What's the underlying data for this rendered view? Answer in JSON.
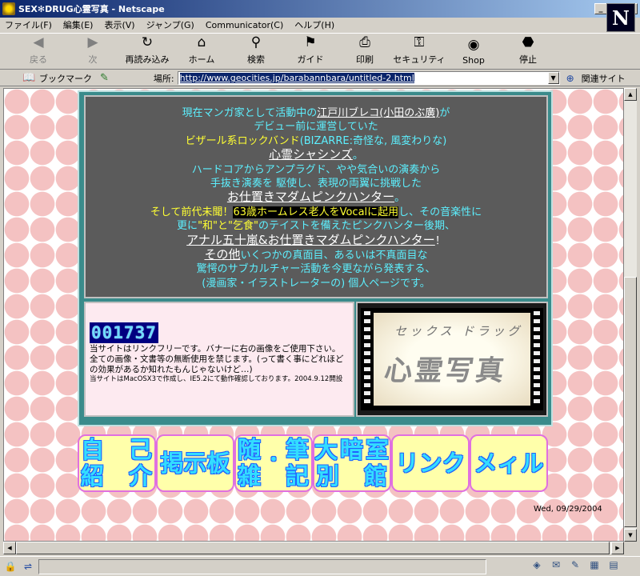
{
  "window": {
    "title": "SEX✻DRUG心霊写真 - Netscape"
  },
  "menu": [
    "ファイル(F)",
    "編集(E)",
    "表示(V)",
    "ジャンプ(G)",
    "Communicator(C)",
    "ヘルプ(H)"
  ],
  "toolbar": [
    {
      "label": "戻る",
      "icon": "back-arrow-icon",
      "glyph": "◀",
      "enabled": false
    },
    {
      "label": "次",
      "icon": "forward-arrow-icon",
      "glyph": "▶",
      "enabled": false
    },
    {
      "label": "再読み込み",
      "icon": "reload-icon",
      "glyph": "↻",
      "enabled": true
    },
    {
      "label": "ホーム",
      "icon": "home-icon",
      "glyph": "⌂",
      "enabled": true
    },
    {
      "label": "検索",
      "icon": "search-icon",
      "glyph": "⚲",
      "enabled": true
    },
    {
      "label": "ガイド",
      "icon": "guide-icon",
      "glyph": "⚑",
      "enabled": true
    },
    {
      "label": "印刷",
      "icon": "print-icon",
      "glyph": "⎙",
      "enabled": true
    },
    {
      "label": "セキュリティ",
      "icon": "lock-icon",
      "glyph": "⚿",
      "enabled": true
    },
    {
      "label": "Shop",
      "icon": "shop-icon",
      "glyph": "◉",
      "enabled": true
    },
    {
      "label": "停止",
      "icon": "stop-icon",
      "glyph": "⬣",
      "enabled": true
    }
  ],
  "logo": "N",
  "location": {
    "bookmark_label": "ブックマーク",
    "label": "場所:",
    "url": "http://www.geocities.jp/barabannbara/untitled-2.html",
    "related_label": "関連サイト"
  },
  "intro": {
    "l1a": "現在マンガ家として活動中の",
    "l1b": "江戸川ブレコ(小田のぶ廣)",
    "l1c": "が",
    "l2": "デビュー前に運営していた",
    "l3a": "ビザール系ロックバンド",
    "l3b": "(BIZARRE:奇怪な, 風変わりな)",
    "l4": "心霊シャシンズ",
    "l4b": "。",
    "l5": "ハードコアからアンプラグド、やや気合いの演奏から",
    "l6": "手抜き演奏を 駆使し、表現の両翼に挑戦した",
    "l7": "お仕置きマダムピンクハンター",
    "l7b": "。",
    "l8a": "そして前代未聞！",
    "l8b": "63歳ホームレス老人をVocalに起用",
    "l8c": "し、その音楽性に",
    "l9a": "更に",
    "l9b": "\"和\"と\"乞食\"",
    "l9c": "のテイストを備えたピンクハンター後期、",
    "l10": "アナル五十嵐&お仕置きマダムピンクハンター",
    "l10b": "！",
    "l11a": "その他",
    "l11b": "いくつかの真面目、あるいは不真面目な",
    "l12": "驚愕のサブカルチャー活動を今更ながら発表する、",
    "l13": "(漫画家・イラストレーターの) 個人ページです。"
  },
  "counter": "001737",
  "notes": {
    "n1": "当サイトはリンクフリーです。バナーに右の画像をご使用下さい。",
    "n2": "全ての画像・文書等の無断使用を禁じます。(って書く事にどれほどの効果があるか知れたもんじゃないけど…)",
    "n3": "当サイトはMacOSX3で作成し、IE5.2にて動作確認しております。2004.9.12開設"
  },
  "banner": {
    "sub": "セックス ドラッグ",
    "main": "心霊写真"
  },
  "nav": [
    {
      "name": "nav-button-profile",
      "chars": [
        "自",
        "己",
        "紹",
        "介"
      ]
    },
    {
      "name": "nav-button-bbs",
      "text": "掲示板"
    },
    {
      "name": "nav-button-essays",
      "chars": [
        "随",
        "筆",
        "雑",
        "記"
      ],
      "dot": "・"
    },
    {
      "name": "nav-button-darkroom",
      "chars": [
        "大",
        "暗",
        "室",
        "別",
        "館"
      ]
    },
    {
      "name": "nav-button-links",
      "text": "リンク"
    },
    {
      "name": "nav-button-mail",
      "text": "メィル"
    }
  ],
  "date": "Wed, 09/29/2004"
}
